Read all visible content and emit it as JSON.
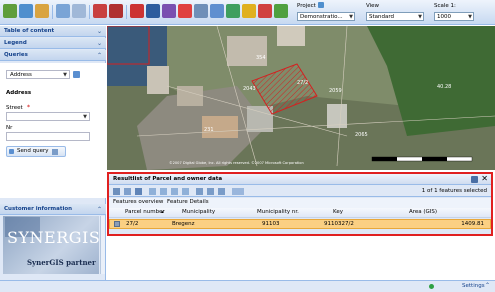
{
  "toolbar": {
    "project_label": "Project",
    "project_value": "Demonstratio...",
    "view_label": "View",
    "view_value": "Standard",
    "scale_label": "Scale 1:",
    "scale_value": "1000"
  },
  "sidebar": {
    "toc_label": "Table of content",
    "legend_label": "Legend",
    "queries_label": "Queries",
    "query_select_value": "Address",
    "section_title": "Address",
    "street_label": "Street",
    "required_mark": "*",
    "nr_label": "Nr",
    "send_query_label": "Send query",
    "customer_info_label": "Customer information",
    "logo_text": "SYNERGIS",
    "partner_text": "SynerGIS partner"
  },
  "map": {
    "parcel_labels": [
      "354",
      "2043",
      "27/2",
      "231",
      "2059",
      "2065",
      "40.28"
    ],
    "attribution": "©2007 Digital Globe, Inc. All rights reserved. ©2007 Microsoft Corporation"
  },
  "results": {
    "title": "Resultlist of Parcel and owner data",
    "selection_info": "1 of 1 features selected",
    "tabs": [
      "Features overview",
      "Feature Details"
    ],
    "columns": [
      "Parcel number",
      "Municipality",
      "Municipality nr.",
      "Key",
      "Area (GIS)"
    ],
    "rows": [
      [
        "27/2",
        "Bregenz",
        "91103",
        "9110327/2",
        "1409.81"
      ]
    ]
  },
  "status": {
    "settings_label": "Settings"
  },
  "colors": {
    "accent": "#15428b",
    "panel_bg": "#dfe8f6",
    "highlight_border": "#e02020",
    "selected_row": "#fbd083",
    "parcel_hatch": "#d42020"
  }
}
